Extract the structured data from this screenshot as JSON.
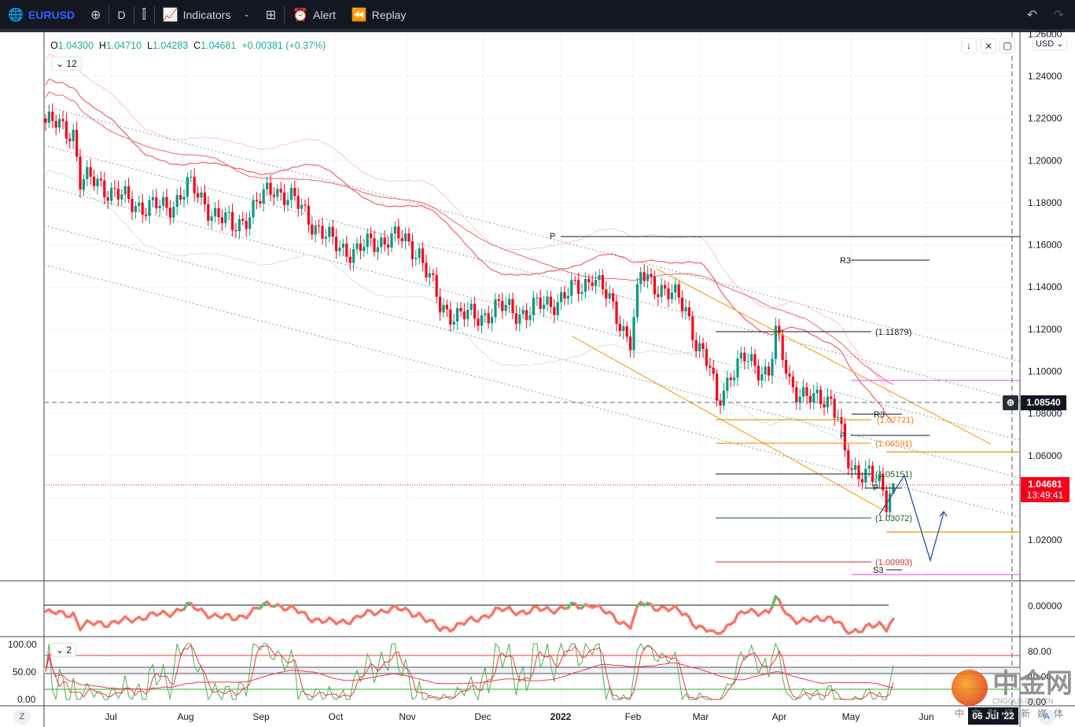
{
  "toolbar": {
    "symbol": "EURUSD",
    "interval": "D",
    "indicators": "Indicators",
    "alert": "Alert",
    "replay": "Replay"
  },
  "legend": {
    "o_label": "O",
    "o": "1.04300",
    "h_label": "H",
    "h": "1.04710",
    "l_label": "L",
    "l": "1.04283",
    "c_label": "C",
    "c": "1.04681",
    "change": "+0.00381 (+0.37%)",
    "indicators_count": "12",
    "sub_count": "2"
  },
  "price_axis": {
    "currency": "USD",
    "crosshair_price": "1.08540",
    "last_price": "1.04681",
    "countdown": "13:49:41"
  },
  "colors": {
    "up": "#089981",
    "down": "#f7001a",
    "ma": "#f4606c",
    "accent": "#2962ff"
  },
  "annotations": {
    "p_top": "P",
    "r3_top": "R3",
    "fib_11879": "(1.11879)",
    "r3_low": "R3",
    "p_low": "P",
    "fib_07721": "(1.07721)",
    "fib_06591": "(1.06591)",
    "fib_05151": "(1.05151)",
    "p_small": "P",
    "fib_03072": "(1.03072)",
    "fib_00993": "(1.00993)",
    "s3": "S3"
  },
  "time_axis": {
    "labels": [
      "Jul",
      "Aug",
      "Sep",
      "Oct",
      "Nov",
      "Dec",
      "2022",
      "Feb",
      "Mar",
      "Apr",
      "May",
      "Jun"
    ],
    "crosshair_date": "06 Jul '22",
    "z_btn": "Z",
    "a_btn": "A"
  },
  "osc_axis": {
    "zero": "0.00000"
  },
  "stoch_axis": {
    "left": [
      "100.00",
      "50.00",
      "0.00"
    ],
    "right": [
      "80.00",
      "40.00",
      "0.00"
    ]
  },
  "watermark": {
    "brand": "中金网",
    "url": "CNGOLD.COM.CN",
    "tagline": "中文财经新媒体"
  },
  "chart_data": {
    "type": "candlestick",
    "price_ticks": [
      1.26,
      1.24,
      1.22,
      1.2,
      1.18,
      1.16,
      1.14,
      1.12,
      1.1,
      1.08,
      1.06,
      1.04,
      1.02
    ],
    "close_waypoints": [
      [
        0,
        1.218
      ],
      [
        8,
        1.214
      ],
      [
        10,
        1.19
      ],
      [
        15,
        1.19
      ],
      [
        24,
        1.18
      ],
      [
        35,
        1.177
      ],
      [
        41,
        1.188
      ],
      [
        49,
        1.175
      ],
      [
        54,
        1.168
      ],
      [
        60,
        1.177
      ],
      [
        66,
        1.188
      ],
      [
        74,
        1.177
      ],
      [
        83,
        1.16
      ],
      [
        90,
        1.157
      ],
      [
        99,
        1.164
      ],
      [
        103,
        1.162
      ],
      [
        108,
        1.157
      ],
      [
        114,
        1.13
      ],
      [
        124,
        1.125
      ],
      [
        130,
        1.13
      ],
      [
        139,
        1.128
      ],
      [
        149,
        1.135
      ],
      [
        155,
        1.14
      ],
      [
        158,
        1.147
      ],
      [
        162,
        1.135
      ],
      [
        169,
        1.115
      ],
      [
        172,
        1.145
      ],
      [
        178,
        1.14
      ],
      [
        185,
        1.13
      ],
      [
        188,
        1.115
      ],
      [
        192,
        1.1
      ],
      [
        194,
        1.085
      ],
      [
        198,
        1.1
      ],
      [
        202,
        1.105
      ],
      [
        209,
        1.1
      ],
      [
        211,
        1.117
      ],
      [
        215,
        1.095
      ],
      [
        222,
        1.085
      ],
      [
        227,
        1.088
      ],
      [
        229,
        1.08
      ],
      [
        231,
        1.06
      ],
      [
        233,
        1.05
      ],
      [
        238,
        1.055
      ],
      [
        241,
        1.045
      ],
      [
        243,
        1.035
      ],
      [
        245,
        1.047
      ]
    ],
    "last": {
      "open": 1.043,
      "high": 1.0471,
      "low": 1.04283,
      "close": 1.04681
    }
  }
}
